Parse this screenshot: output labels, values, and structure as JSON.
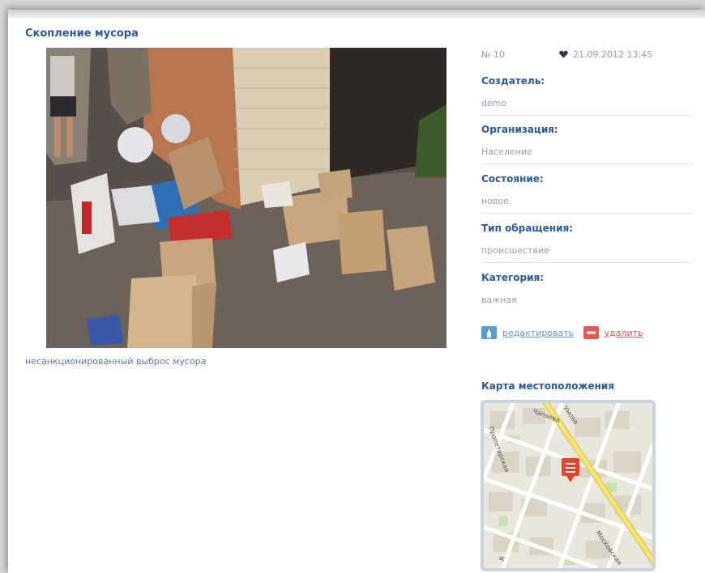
{
  "issue": {
    "title": "Скопление мусора",
    "number": "№ 10",
    "date": "21.09.2012 13:45",
    "caption": "несанкционированный выброс мусора"
  },
  "fields": [
    {
      "label": "Создатель:",
      "value": "demo"
    },
    {
      "label": "Организация:",
      "value": "Население"
    },
    {
      "label": "Состояние:",
      "value": "новое"
    },
    {
      "label": "Тип обращения:",
      "value": "происшествие"
    },
    {
      "label": "Категория:",
      "value": "важная"
    }
  ],
  "actions": {
    "edit_label": "редактировать",
    "delete_label": "удалить"
  },
  "map": {
    "title": "Карта местоположения",
    "street_labels": [
      "Чапаева",
      "Пролетарская",
      "Умова",
      "Московская",
      "Я"
    ]
  },
  "colors": {
    "heading": "#2a5a99",
    "muted": "#8fa3bb",
    "edit_icon": "#5b9bd5",
    "delete_icon": "#e4584f",
    "map_marker": "#e8442c"
  },
  "icons": [
    "heart-icon",
    "edit-icon",
    "delete-icon",
    "map-marker-icon"
  ]
}
